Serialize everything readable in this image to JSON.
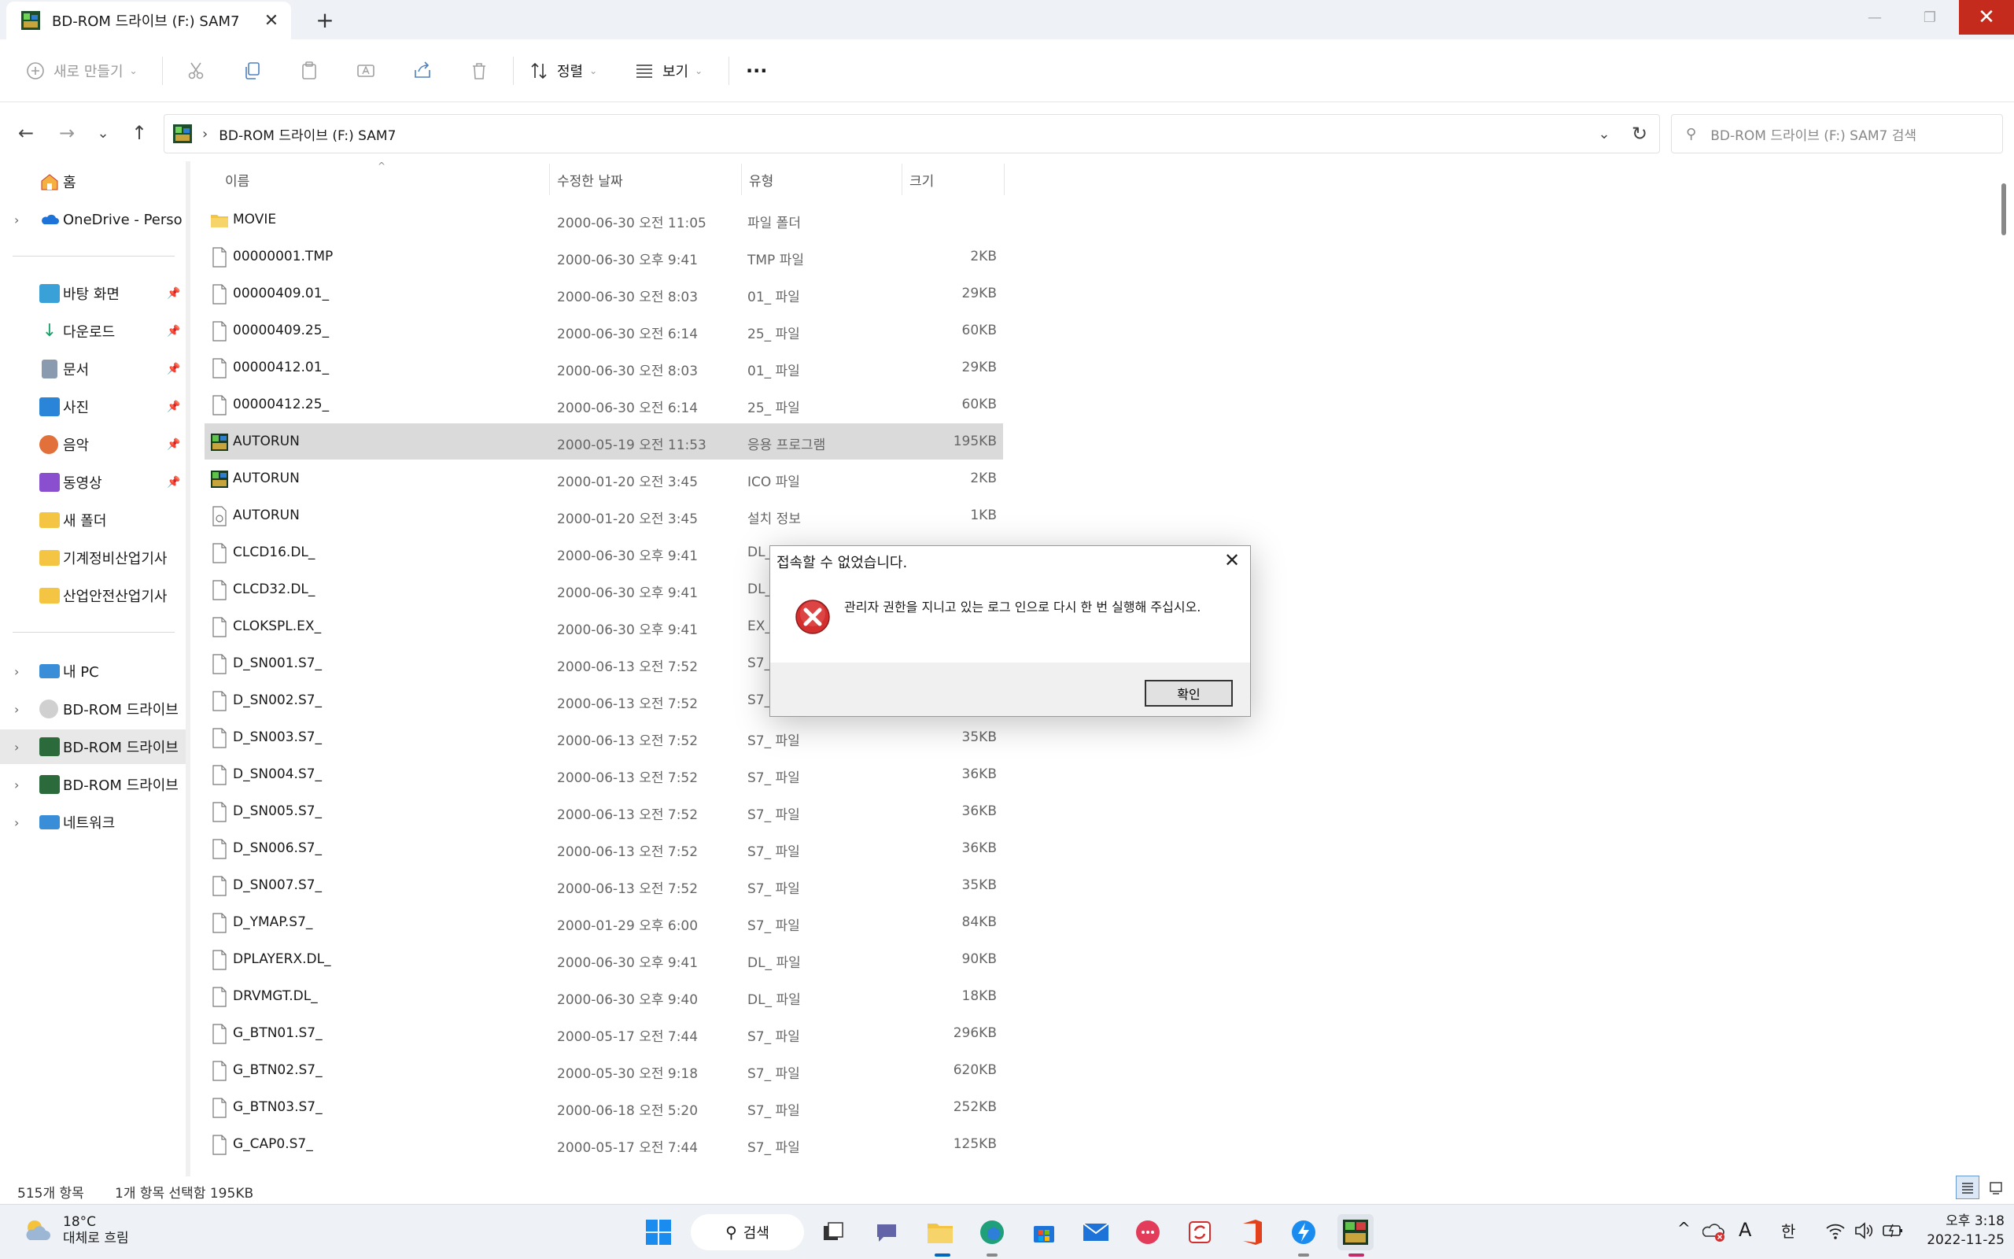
{
  "window": {
    "tab_title": "BD-ROM 드라이브 (F:) SAM7",
    "new_tab": "+",
    "close_tab": "✕",
    "minimize": "—",
    "maximize": "❐",
    "close": "✕"
  },
  "toolbar": {
    "new_label": "새로 만들기",
    "sort_label": "정렬",
    "view_label": "보기",
    "more": "···"
  },
  "address": {
    "path": "BD-ROM 드라이브 (F:) SAM7",
    "search_placeholder": "BD-ROM 드라이브 (F:) SAM7 검색"
  },
  "sidebar": {
    "home": "홈",
    "onedrive": "OneDrive - Persona",
    "quick": [
      {
        "label": "바탕 화면",
        "icon": "desktop-icon"
      },
      {
        "label": "다운로드",
        "icon": "download-icon"
      },
      {
        "label": "문서",
        "icon": "document-icon"
      },
      {
        "label": "사진",
        "icon": "pictures-icon"
      },
      {
        "label": "음악",
        "icon": "music-icon"
      },
      {
        "label": "동영상",
        "icon": "video-icon"
      },
      {
        "label": "새 폴더",
        "icon": "folder-icon"
      },
      {
        "label": "기계정비산업기사",
        "icon": "folder-icon"
      },
      {
        "label": "산업안전산업기사",
        "icon": "folder-icon"
      }
    ],
    "pc": "내 PC",
    "drive1": "BD-ROM 드라이브",
    "drive2": "BD-ROM 드라이브",
    "drive3": "BD-ROM 드라이브",
    "network": "네트워크"
  },
  "columns": {
    "name": "이름",
    "date": "수정한 날짜",
    "type": "유형",
    "size": "크기"
  },
  "files": [
    {
      "name": "MOVIE",
      "date": "2000-06-30 오전 11:05",
      "type": "파일 폴더",
      "size": "",
      "kind": "folder"
    },
    {
      "name": "00000001.TMP",
      "date": "2000-06-30 오후 9:41",
      "type": "TMP 파일",
      "size": "2KB",
      "kind": "file"
    },
    {
      "name": "00000409.01_",
      "date": "2000-06-30 오전 8:03",
      "type": "01_ 파일",
      "size": "29KB",
      "kind": "file"
    },
    {
      "name": "00000409.25_",
      "date": "2000-06-30 오전 6:14",
      "type": "25_ 파일",
      "size": "60KB",
      "kind": "file"
    },
    {
      "name": "00000412.01_",
      "date": "2000-06-30 오전 8:03",
      "type": "01_ 파일",
      "size": "29KB",
      "kind": "file"
    },
    {
      "name": "00000412.25_",
      "date": "2000-06-30 오전 6:14",
      "type": "25_ 파일",
      "size": "60KB",
      "kind": "file"
    },
    {
      "name": "AUTORUN",
      "date": "2000-05-19 오전 11:53",
      "type": "응용 프로그램",
      "size": "195KB",
      "kind": "app"
    },
    {
      "name": "AUTORUN",
      "date": "2000-01-20 오전 3:45",
      "type": "ICO 파일",
      "size": "2KB",
      "kind": "app"
    },
    {
      "name": "AUTORUN",
      "date": "2000-01-20 오전 3:45",
      "type": "설치 정보",
      "size": "1KB",
      "kind": "inf"
    },
    {
      "name": "CLCD16.DL_",
      "date": "2000-06-30 오후 9:41",
      "type": "DL_",
      "size": "",
      "kind": "file"
    },
    {
      "name": "CLCD32.DL_",
      "date": "2000-06-30 오후 9:41",
      "type": "DL_",
      "size": "",
      "kind": "file"
    },
    {
      "name": "CLOKSPL.EX_",
      "date": "2000-06-30 오후 9:41",
      "type": "EX_",
      "size": "",
      "kind": "file"
    },
    {
      "name": "D_SN001.S7_",
      "date": "2000-06-13 오전 7:52",
      "type": "S7_",
      "size": "",
      "kind": "file"
    },
    {
      "name": "D_SN002.S7_",
      "date": "2000-06-13 오전 7:52",
      "type": "S7_",
      "size": "",
      "kind": "file"
    },
    {
      "name": "D_SN003.S7_",
      "date": "2000-06-13 오전 7:52",
      "type": "S7_ 파일",
      "size": "35KB",
      "kind": "file"
    },
    {
      "name": "D_SN004.S7_",
      "date": "2000-06-13 오전 7:52",
      "type": "S7_ 파일",
      "size": "36KB",
      "kind": "file"
    },
    {
      "name": "D_SN005.S7_",
      "date": "2000-06-13 오전 7:52",
      "type": "S7_ 파일",
      "size": "36KB",
      "kind": "file"
    },
    {
      "name": "D_SN006.S7_",
      "date": "2000-06-13 오전 7:52",
      "type": "S7_ 파일",
      "size": "36KB",
      "kind": "file"
    },
    {
      "name": "D_SN007.S7_",
      "date": "2000-06-13 오전 7:52",
      "type": "S7_ 파일",
      "size": "35KB",
      "kind": "file"
    },
    {
      "name": "D_YMAP.S7_",
      "date": "2000-01-29 오후 6:00",
      "type": "S7_ 파일",
      "size": "84KB",
      "kind": "file"
    },
    {
      "name": "DPLAYERX.DL_",
      "date": "2000-06-30 오후 9:41",
      "type": "DL_ 파일",
      "size": "90KB",
      "kind": "file"
    },
    {
      "name": "DRVMGT.DL_",
      "date": "2000-06-30 오후 9:40",
      "type": "DL_ 파일",
      "size": "18KB",
      "kind": "file"
    },
    {
      "name": "G_BTN01.S7_",
      "date": "2000-05-17 오전 7:44",
      "type": "S7_ 파일",
      "size": "296KB",
      "kind": "file"
    },
    {
      "name": "G_BTN02.S7_",
      "date": "2000-05-30 오전 9:18",
      "type": "S7_ 파일",
      "size": "620KB",
      "kind": "file"
    },
    {
      "name": "G_BTN03.S7_",
      "date": "2000-06-18 오전 5:20",
      "type": "S7_ 파일",
      "size": "252KB",
      "kind": "file"
    },
    {
      "name": "G_CAP0.S7_",
      "date": "2000-05-17 오전 7:44",
      "type": "S7_ 파일",
      "size": "125KB",
      "kind": "file"
    }
  ],
  "selected_index": 6,
  "status": {
    "count": "515개 항목",
    "selection": "1개 항목 선택함 195KB"
  },
  "dialog": {
    "title": "접속할 수 없었습니다.",
    "message": "관리자 권한을 지니고 있는 로그 인으로 다시 한 번 실행해 주십시오.",
    "ok": "확인",
    "close": "✕"
  },
  "taskbar": {
    "temperature": "18°C",
    "weather": "대체로 흐림",
    "search": "검색",
    "ime_a": "A",
    "ime_han": "한",
    "time": "오후 3:18",
    "date": "2022-11-25"
  },
  "colors": {
    "accent": "#0067c0",
    "close_red": "#c42b1c",
    "selection": "#dadada",
    "folder": "#f4c542"
  }
}
